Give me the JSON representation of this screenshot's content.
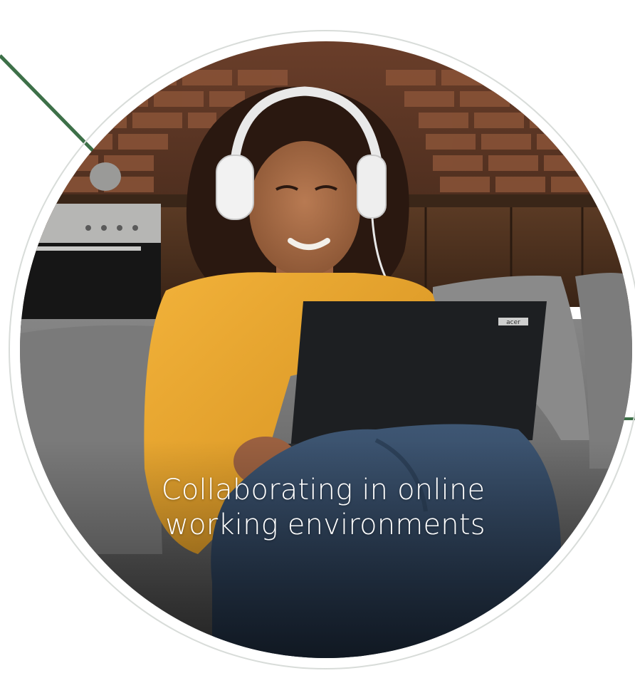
{
  "caption": {
    "line1": "Collaborating in online",
    "line2": "working environments"
  },
  "laptop": {
    "brand": "acer"
  },
  "colors": {
    "accent_green": "#3d7048",
    "ring": "#d8dcd9",
    "caption_text": "#ffffff"
  }
}
